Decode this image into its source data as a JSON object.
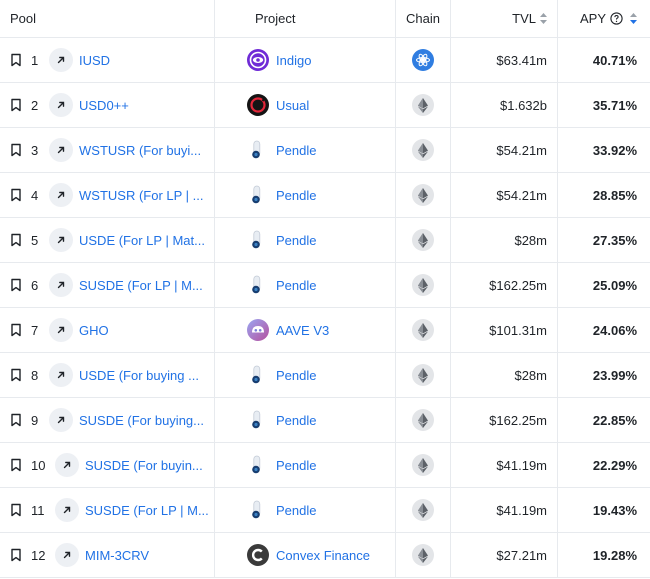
{
  "header": {
    "pool": "Pool",
    "project": "Project",
    "chain": "Chain",
    "tvl": "TVL",
    "apy": "APY"
  },
  "rows": [
    {
      "rank": "1",
      "pool": "IUSD",
      "project": "Indigo",
      "logo": "indigo",
      "chain": "cosmos",
      "tvl": "$63.41m",
      "apy": "40.71%"
    },
    {
      "rank": "2",
      "pool": "USD0++",
      "project": "Usual",
      "logo": "usual",
      "chain": "ethereum",
      "tvl": "$1.632b",
      "apy": "35.71%"
    },
    {
      "rank": "3",
      "pool": "WSTUSR (For buyi...",
      "project": "Pendle",
      "logo": "pendle",
      "chain": "ethereum",
      "tvl": "$54.21m",
      "apy": "33.92%"
    },
    {
      "rank": "4",
      "pool": "WSTUSR (For LP | ...",
      "project": "Pendle",
      "logo": "pendle",
      "chain": "ethereum",
      "tvl": "$54.21m",
      "apy": "28.85%"
    },
    {
      "rank": "5",
      "pool": "USDE (For LP | Mat...",
      "project": "Pendle",
      "logo": "pendle",
      "chain": "ethereum",
      "tvl": "$28m",
      "apy": "27.35%"
    },
    {
      "rank": "6",
      "pool": "SUSDE (For LP | M...",
      "project": "Pendle",
      "logo": "pendle",
      "chain": "ethereum",
      "tvl": "$162.25m",
      "apy": "25.09%"
    },
    {
      "rank": "7",
      "pool": "GHO",
      "project": "AAVE V3",
      "logo": "aave",
      "chain": "ethereum",
      "tvl": "$101.31m",
      "apy": "24.06%"
    },
    {
      "rank": "8",
      "pool": "USDE (For buying ...",
      "project": "Pendle",
      "logo": "pendle",
      "chain": "ethereum",
      "tvl": "$28m",
      "apy": "23.99%"
    },
    {
      "rank": "9",
      "pool": "SUSDE (For buying...",
      "project": "Pendle",
      "logo": "pendle",
      "chain": "ethereum",
      "tvl": "$162.25m",
      "apy": "22.85%"
    },
    {
      "rank": "10",
      "pool": "SUSDE (For buyin...",
      "project": "Pendle",
      "logo": "pendle",
      "chain": "ethereum",
      "tvl": "$41.19m",
      "apy": "22.29%"
    },
    {
      "rank": "11",
      "pool": "SUSDE (For LP | M...",
      "project": "Pendle",
      "logo": "pendle",
      "chain": "ethereum",
      "tvl": "$41.19m",
      "apy": "19.43%"
    },
    {
      "rank": "12",
      "pool": "MIM-3CRV",
      "project": "Convex Finance",
      "logo": "convex",
      "chain": "ethereum",
      "tvl": "$27.21m",
      "apy": "19.28%"
    }
  ],
  "colors": {
    "link": "#2172e5",
    "border": "#e7eaee",
    "active_sort": "#2172e5"
  }
}
